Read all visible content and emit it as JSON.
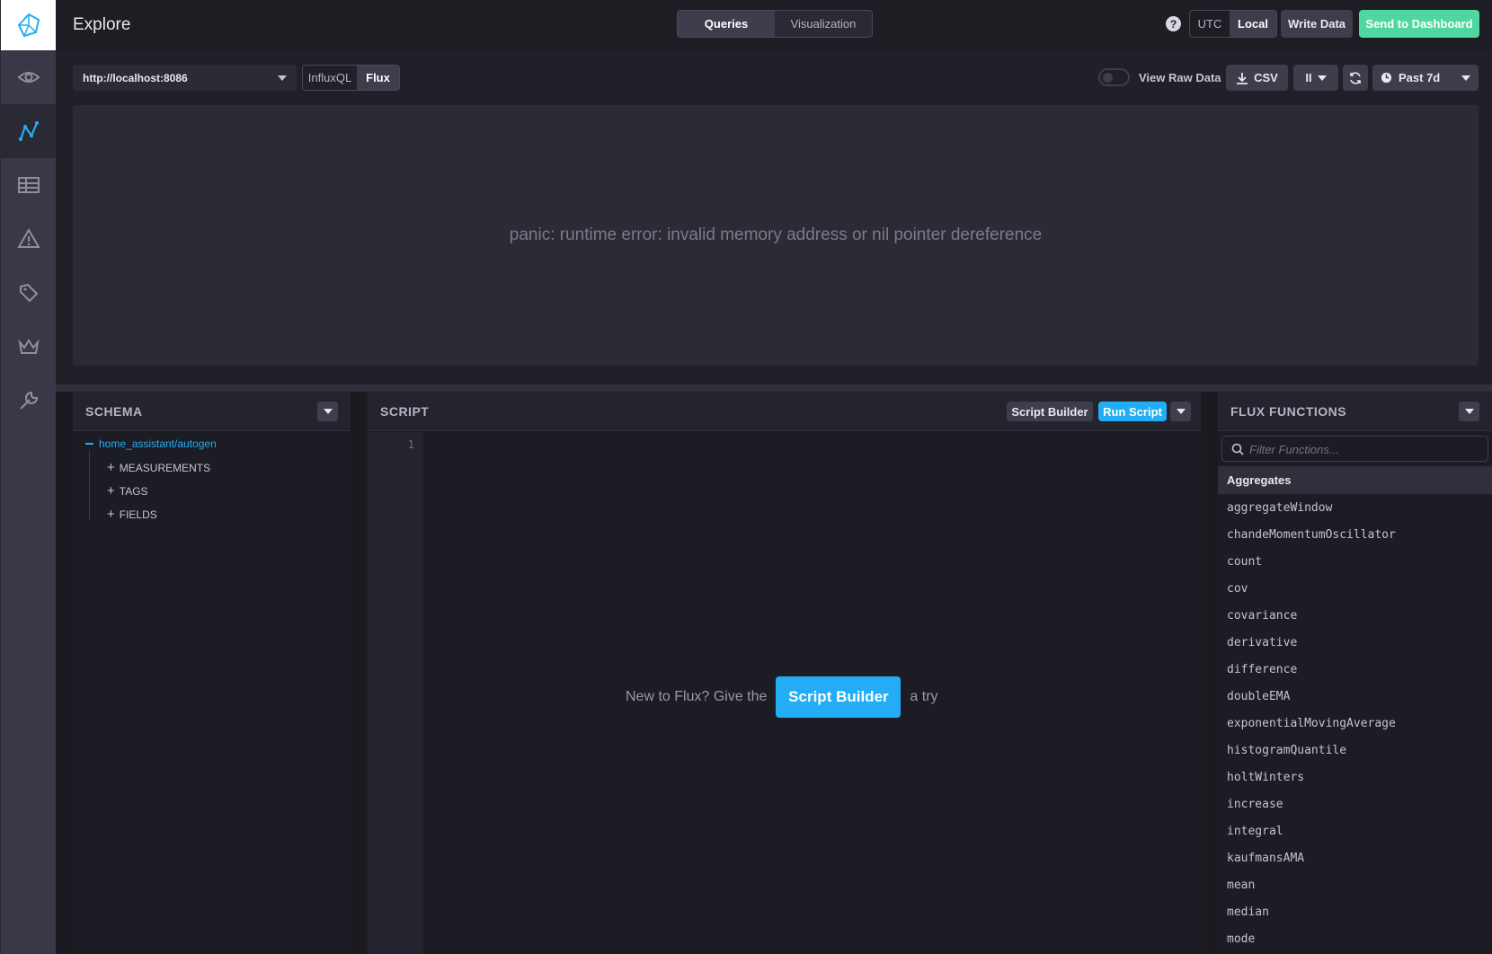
{
  "sidebar": {
    "items": [
      {
        "name": "eye-icon"
      },
      {
        "name": "graph-icon",
        "active": true
      },
      {
        "name": "table-icon"
      },
      {
        "name": "alert-icon"
      },
      {
        "name": "tags-icon"
      },
      {
        "name": "crown-icon"
      },
      {
        "name": "wrench-icon"
      }
    ]
  },
  "header": {
    "title": "Explore",
    "mode_tabs": [
      "Queries",
      "Visualization"
    ],
    "help": "?",
    "timezone": [
      "UTC",
      "Local"
    ],
    "write_data": "Write Data",
    "send_to_dashboard": "Send to Dashboard"
  },
  "toolbar": {
    "source": "http://localhost:8086",
    "languages": [
      "InfluxQL",
      "Flux"
    ],
    "view_raw_data": "View Raw Data",
    "csv": "CSV",
    "pause": "II",
    "time_range": "Past 7d"
  },
  "graph": {
    "error": "panic: runtime error: invalid memory address or nil pointer dereference"
  },
  "schema": {
    "title": "SCHEMA",
    "database": "home_assistant/autogen",
    "children": [
      "MEASUREMENTS",
      "TAGS",
      "FIELDS"
    ]
  },
  "script": {
    "title": "SCRIPT",
    "script_builder": "Script Builder",
    "run_script": "Run Script",
    "line_number": "1",
    "hint_prefix": "New to Flux? Give the",
    "hint_button": "Script Builder",
    "hint_suffix": "a try"
  },
  "flux_functions": {
    "title": "FLUX FUNCTIONS",
    "filter_placeholder": "Filter Functions...",
    "category": "Aggregates",
    "items": [
      "aggregateWindow",
      "chandeMomentumOscillator",
      "count",
      "cov",
      "covariance",
      "derivative",
      "difference",
      "doubleEMA",
      "exponentialMovingAverage",
      "histogramQuantile",
      "holtWinters",
      "increase",
      "integral",
      "kaufmansAMA",
      "mean",
      "median",
      "mode"
    ]
  },
  "colors": {
    "accent_blue": "#22adf6",
    "send_green": "#4ed8a0",
    "background": "#1a1a20"
  }
}
